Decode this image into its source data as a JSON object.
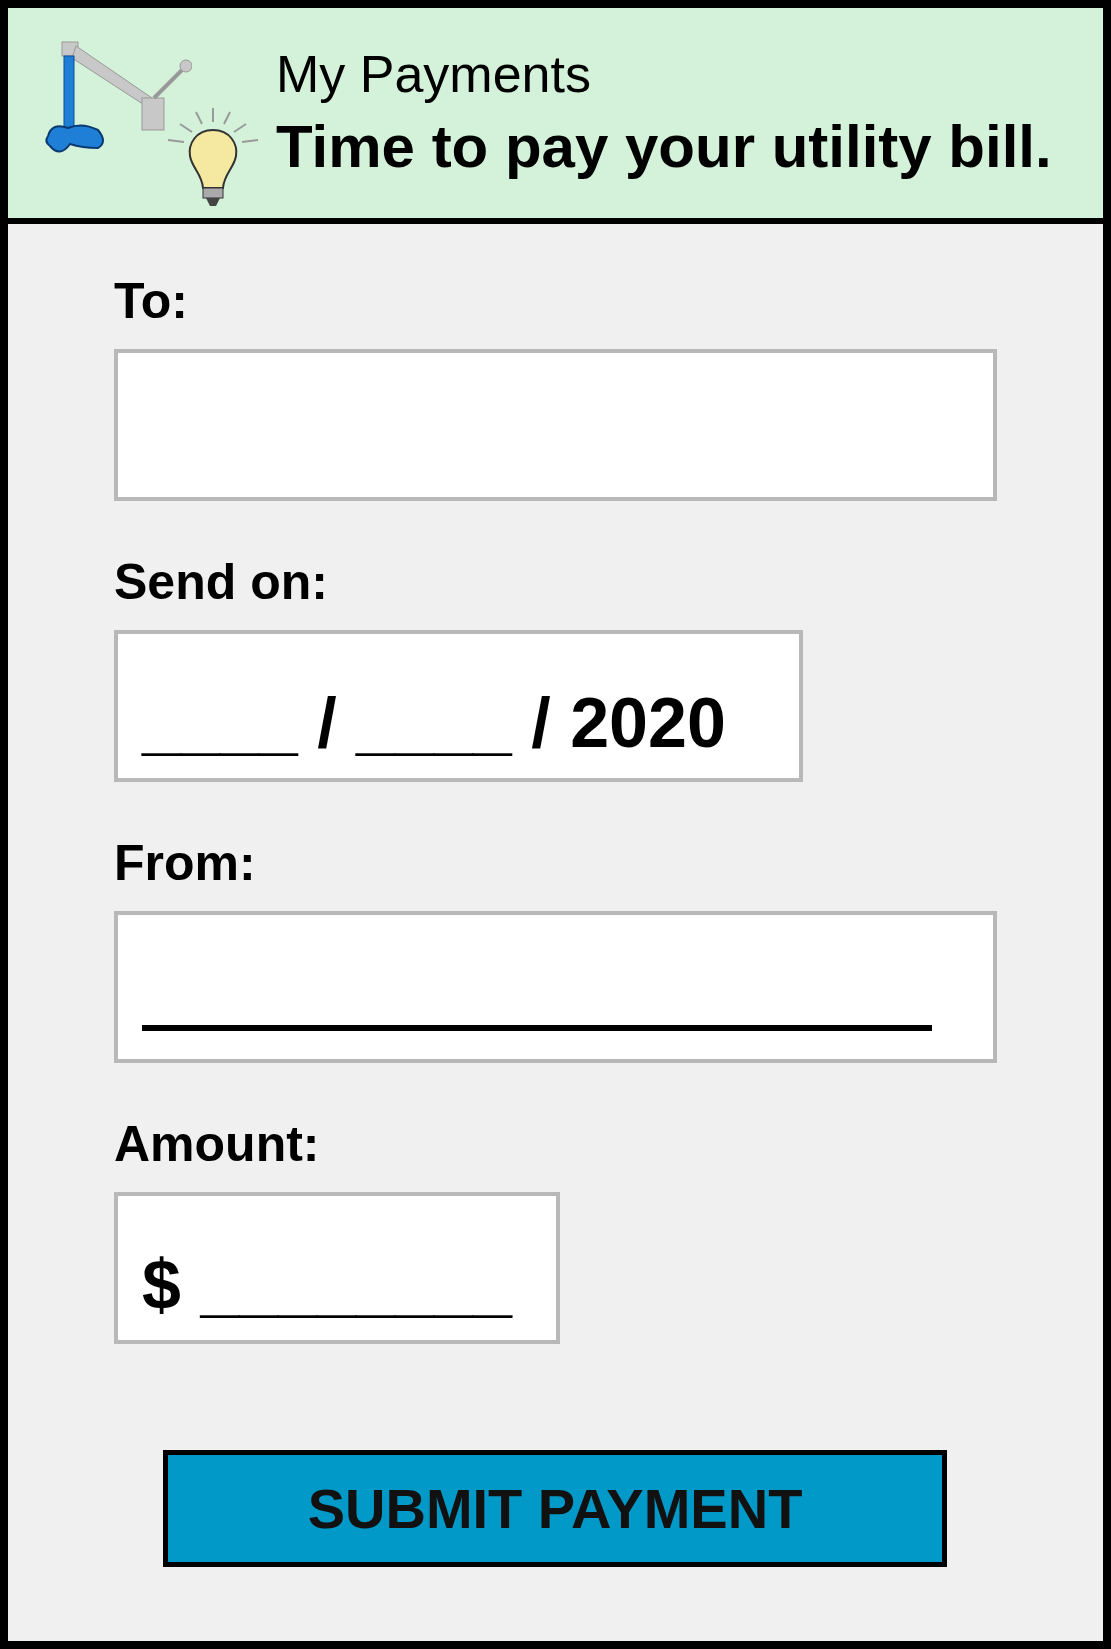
{
  "header": {
    "title": "My Payments",
    "subtitle": "Time to pay your utility bill."
  },
  "fields": [
    {
      "label": "To:",
      "kind": "blank"
    },
    {
      "label": "Send on:",
      "kind": "text",
      "value": "____ / ____ / 2020"
    },
    {
      "label": "From:",
      "kind": "line"
    },
    {
      "label": "Amount:",
      "kind": "text",
      "value": "$ ________"
    }
  ],
  "submit_button": "SUBMIT PAYMENT"
}
